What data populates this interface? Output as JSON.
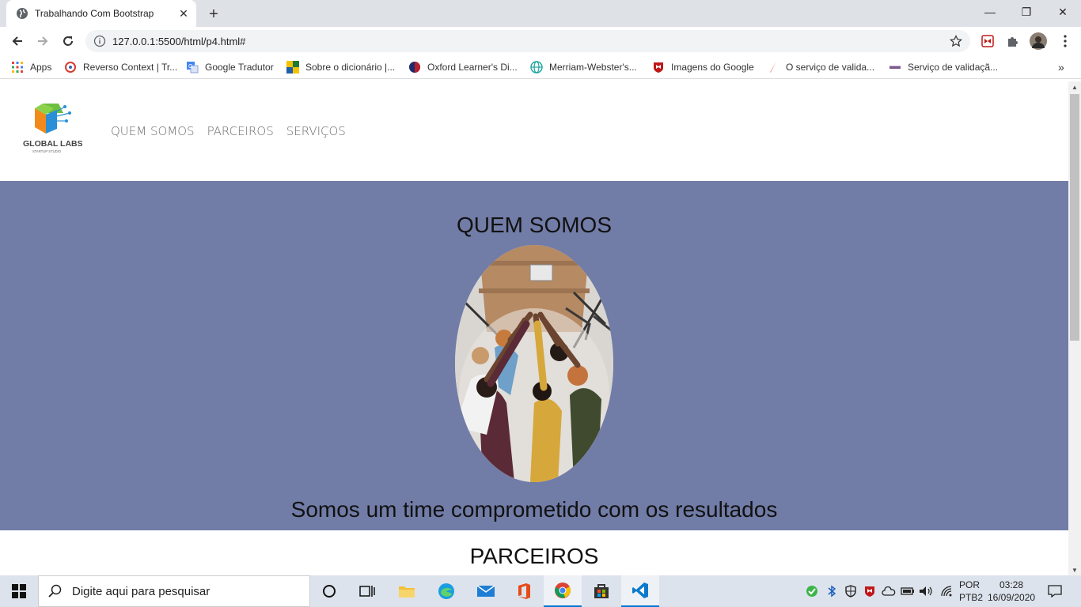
{
  "browser": {
    "tab_title": "Trabalhando Com Bootstrap",
    "url": "127.0.0.1:5500/html/p4.html#",
    "bookmarks": [
      "Apps",
      "Reverso Context | Tr...",
      "Google Tradutor",
      "Sobre o dicionário |...",
      "Oxford Learner's Di...",
      "Merriam-Webster's...",
      "Imagens do Google",
      "O serviço de valida...",
      "Serviço de validaçã..."
    ]
  },
  "site": {
    "logo_text": "GLOBAL LABS",
    "logo_sub": "STARTUP STUDIO",
    "nav": [
      "QUEM SOMOS",
      "PARCEIROS",
      "SERVIÇOS"
    ],
    "hero_title": "QUEM SOMOS",
    "hero_tagline": "Somos um time comprometido com os resultados",
    "next_section_title": "PARCEIROS",
    "hero_color": "#717ca7"
  },
  "taskbar": {
    "search_placeholder": "Digite aqui para pesquisar",
    "lang_1": "POR",
    "lang_2": "PTB2",
    "time": "03:28",
    "date": "16/09/2020"
  }
}
